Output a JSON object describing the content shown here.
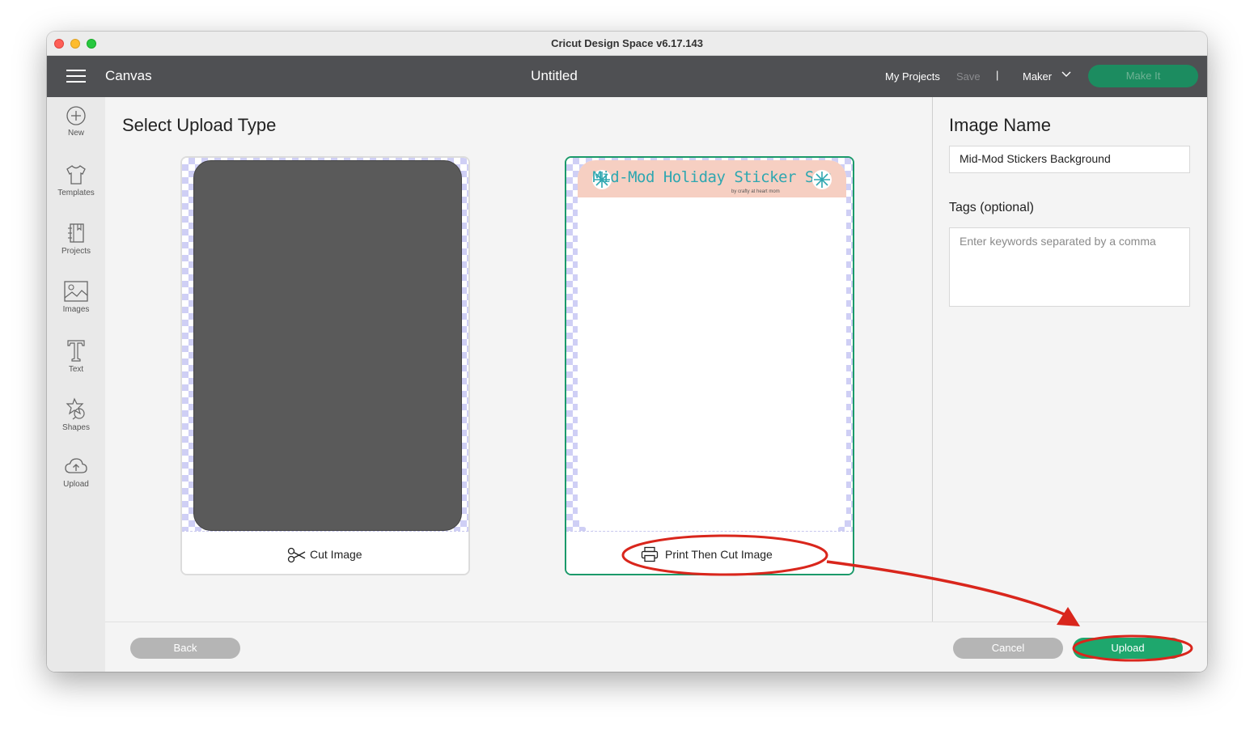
{
  "window": {
    "title": "Cricut Design Space  v6.17.143"
  },
  "header": {
    "section": "Canvas",
    "document_title": "Untitled",
    "my_projects": "My Projects",
    "save": "Save",
    "separator": "|",
    "machine": "Maker",
    "make_it": "Make It"
  },
  "sidebar": {
    "items": [
      {
        "label": "New",
        "icon": "plus-circle-icon"
      },
      {
        "label": "Templates",
        "icon": "tshirt-icon"
      },
      {
        "label": "Projects",
        "icon": "notebook-icon"
      },
      {
        "label": "Images",
        "icon": "image-icon"
      },
      {
        "label": "Text",
        "icon": "text-t-icon"
      },
      {
        "label": "Shapes",
        "icon": "shapes-icon"
      },
      {
        "label": "Upload",
        "icon": "cloud-upload-icon"
      }
    ]
  },
  "main": {
    "title": "Select Upload Type",
    "cards": [
      {
        "label": "Cut Image",
        "icon": "scissors-icon",
        "selected": false
      },
      {
        "label": "Print Then Cut Image",
        "icon": "printer-icon",
        "selected": true,
        "preview_title": "Mid-Mod Holiday Sticker Set",
        "preview_subtitle": "by crafty at heart mom"
      }
    ]
  },
  "right_panel": {
    "image_name_label": "Image Name",
    "image_name_value": "Mid-Mod Stickers Background",
    "tags_label": "Tags (optional)",
    "tags_placeholder": "Enter keywords separated by a comma"
  },
  "footer": {
    "back": "Back",
    "cancel": "Cancel",
    "upload": "Upload"
  },
  "colors": {
    "header_bg": "#4f5053",
    "accent_green": "#1ea76d",
    "selected_border": "#1b9a6a",
    "annotation_red": "#d9261c"
  }
}
